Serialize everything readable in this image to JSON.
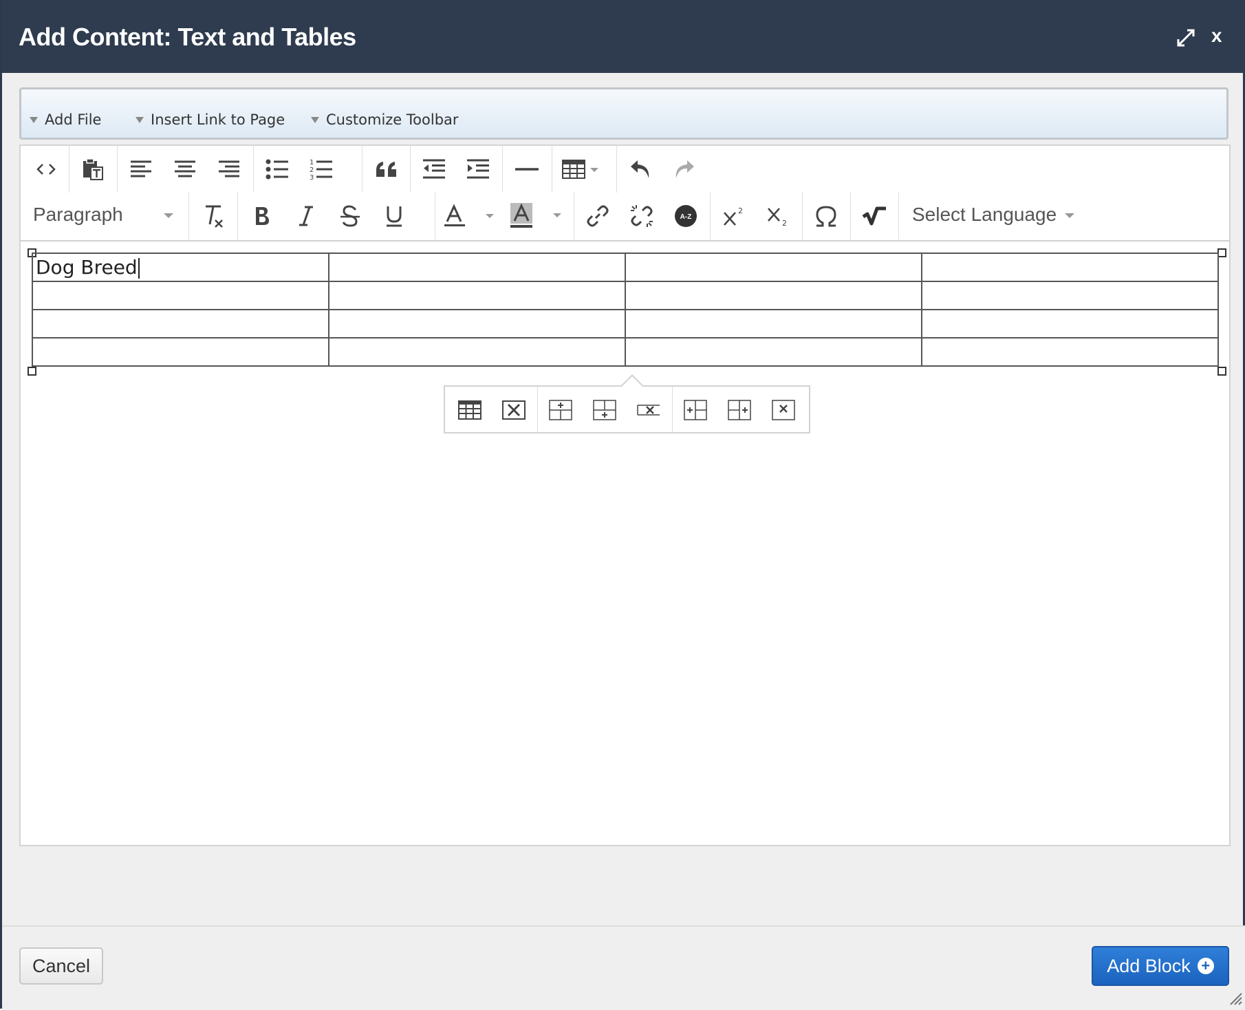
{
  "dialog": {
    "title": "Add Content: Text and Tables",
    "close_label": "x"
  },
  "panel_bar": {
    "items": [
      {
        "label": "Add File"
      },
      {
        "label": "Insert Link to Page"
      },
      {
        "label": "Customize Toolbar"
      }
    ]
  },
  "toolbar": {
    "row1": [
      "code-view-icon",
      "paste-text-icon",
      "align-left-icon",
      "align-center-icon",
      "align-right-icon",
      "bullet-list-icon",
      "numbered-list-icon",
      "blockquote-icon",
      "outdent-icon",
      "indent-icon",
      "horizontal-rule-icon",
      "table-icon",
      "undo-icon",
      "redo-icon"
    ],
    "row2": [
      "clear-format-icon",
      "bold-icon",
      "italic-icon",
      "strikethrough-icon",
      "underline-icon",
      "text-color-icon",
      "background-color-icon",
      "link-icon",
      "unlink-icon",
      "spellcheck-icon",
      "superscript-icon",
      "subscript-icon",
      "special-char-icon",
      "equation-icon"
    ],
    "format_select": "Paragraph",
    "language_select": "Select Language",
    "spellcheck_label": "A-Z"
  },
  "table": {
    "rows": [
      [
        "Dog Breed",
        "",
        "",
        ""
      ],
      [
        "",
        "",
        "",
        ""
      ],
      [
        "",
        "",
        "",
        ""
      ],
      [
        "",
        "",
        "",
        ""
      ]
    ]
  },
  "table_popup": {
    "tools": [
      "table-properties-icon",
      "delete-table-icon",
      "insert-row-before-icon",
      "insert-row-after-icon",
      "delete-row-icon",
      "insert-col-before-icon",
      "insert-col-after-icon",
      "delete-col-icon"
    ]
  },
  "footer": {
    "cancel_label": "Cancel",
    "add_label": "Add Block"
  },
  "colors": {
    "titlebar": "#2f3c4f",
    "primary_button": "#1f67c2"
  }
}
